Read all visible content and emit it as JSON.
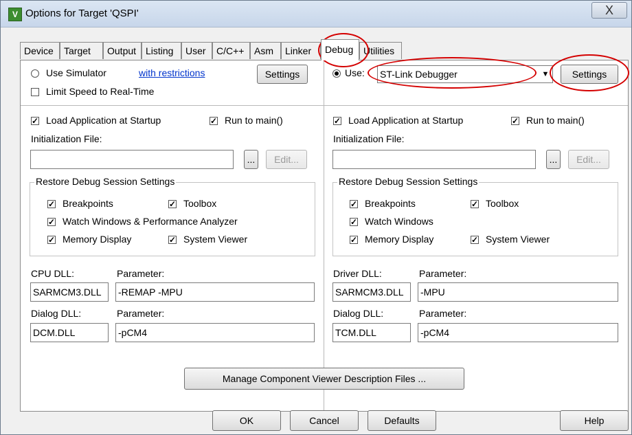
{
  "window": {
    "title": "Options for Target 'QSPI'",
    "app_icon": "V",
    "close_glyph": "X"
  },
  "tabs": [
    "Device",
    "Target",
    "Output",
    "Listing",
    "User",
    "C/C++",
    "Asm",
    "Linker",
    "Debug",
    "Utilities"
  ],
  "active_tab": "Debug",
  "left": {
    "use_simulator": "Use Simulator",
    "restrictions_link": "with restrictions",
    "settings": "Settings",
    "limit_speed": "Limit Speed to Real-Time",
    "load_app": "Load Application at Startup",
    "run_to_main": "Run to main()",
    "init_file_label": "Initialization File:",
    "init_file_value": "",
    "browse": "...",
    "edit": "Edit...",
    "restore_group": "Restore Debug Session Settings",
    "breakpoints": "Breakpoints",
    "toolbox": "Toolbox",
    "watch": "Watch Windows & Performance Analyzer",
    "memory": "Memory Display",
    "system_viewer": "System Viewer",
    "cpu_dll_label": "CPU DLL:",
    "cpu_dll_value": "SARMCM3.DLL",
    "param_label_1": "Parameter:",
    "cpu_param_value": "-REMAP -MPU",
    "dialog_dll_label": "Dialog DLL:",
    "dialog_dll_value": "DCM.DLL",
    "param_label_2": "Parameter:",
    "dialog_param_value": "-pCM4"
  },
  "right": {
    "use": "Use:",
    "debugger_value": "ST-Link Debugger",
    "settings": "Settings",
    "load_app": "Load Application at Startup",
    "run_to_main": "Run to main()",
    "init_file_label": "Initialization File:",
    "init_file_value": "",
    "browse": "...",
    "edit": "Edit...",
    "restore_group": "Restore Debug Session Settings",
    "breakpoints": "Breakpoints",
    "toolbox": "Toolbox",
    "watch": "Watch Windows",
    "memory": "Memory Display",
    "system_viewer": "System Viewer",
    "driver_dll_label": "Driver DLL:",
    "driver_dll_value": "SARMCM3.DLL",
    "param_label_1": "Parameter:",
    "driver_param_value": "-MPU",
    "dialog_dll_label": "Dialog DLL:",
    "dialog_dll_value": "TCM.DLL",
    "param_label_2": "Parameter:",
    "dialog_param_value": "-pCM4"
  },
  "manage_button": "Manage Component Viewer Description Files ...",
  "footer": {
    "ok": "OK",
    "cancel": "Cancel",
    "defaults": "Defaults",
    "help": "Help"
  },
  "annotation_color": "#d40000"
}
